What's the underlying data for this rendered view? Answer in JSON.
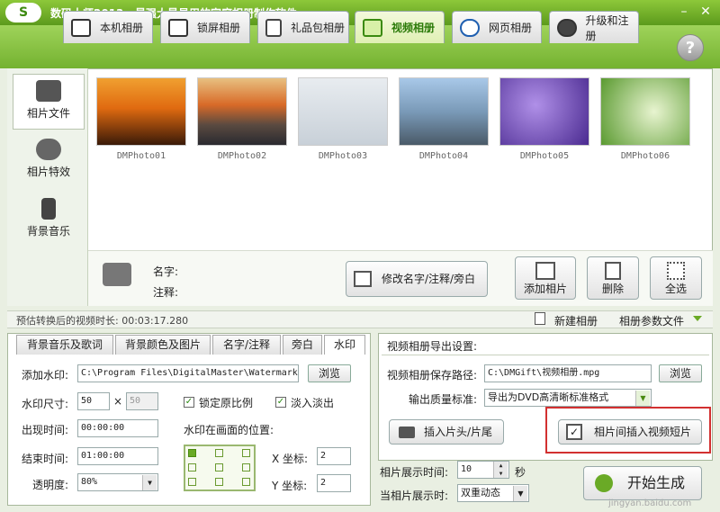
{
  "titlebar": {
    "logo": "S",
    "app_name": "数码大师2013",
    "slogan": "最强大最易用的家庭相册制作软件"
  },
  "tabs": [
    {
      "label": "本机相册"
    },
    {
      "label": "锁屏相册"
    },
    {
      "label": "礼品包相册"
    },
    {
      "label": "视频相册"
    },
    {
      "label": "网页相册"
    },
    {
      "label": "升级和注册"
    }
  ],
  "help_label": "?",
  "sidenav": {
    "items": [
      {
        "label": "相片文件"
      },
      {
        "label": "相片特效"
      },
      {
        "label": "背景音乐"
      }
    ]
  },
  "photos": [
    {
      "name": "DMPhoto01"
    },
    {
      "name": "DMPhoto02"
    },
    {
      "name": "DMPhoto03"
    },
    {
      "name": "DMPhoto04"
    },
    {
      "name": "DMPhoto05"
    },
    {
      "name": "DMPhoto06"
    }
  ],
  "info": {
    "name_label": "名字:",
    "note_label": "注释:",
    "edit_button": "修改名字/注释/旁白"
  },
  "actions": {
    "add": "添加相片",
    "delete": "删除",
    "select_all": "全选"
  },
  "status": {
    "estimate": "预估转换后的视频时长: 00:03:17.280",
    "new_album": "新建相册",
    "album_params": "相册参数文件"
  },
  "subtabs": [
    {
      "label": "背景音乐及歌词"
    },
    {
      "label": "背景颜色及图片"
    },
    {
      "label": "名字/注释"
    },
    {
      "label": "旁白"
    },
    {
      "label": "水印"
    }
  ],
  "watermark": {
    "add_label": "添加水印:",
    "path_value": "C:\\Program Files\\DigitalMaster\\Watermark",
    "browse": "浏览",
    "size_label": "水印尺寸:",
    "size_w": "50",
    "size_times": "×",
    "size_h": "50",
    "lock_ratio": "锁定原比例",
    "fade": "淡入淡出",
    "appear_label": "出现时间:",
    "appear_value": "00:00:00",
    "end_label": "结束时间:",
    "end_value": "01:00:00",
    "opacity_label": "透明度:",
    "opacity_value": "80%",
    "position_label": "水印在画面的位置:",
    "x_label": "X 坐标:",
    "x_value": "2",
    "y_label": "Y 坐标:",
    "y_value": "2"
  },
  "export": {
    "header": "视频相册导出设置:",
    "path_label": "视频相册保存路径:",
    "path_value": "C:\\DMGift\\视频相册.mpg",
    "browse": "浏览",
    "quality_label": "输出质量标准:",
    "quality_value": "导出为DVD高清晰标准格式",
    "insert_head": "插入片头/片尾",
    "insert_short": "相片间插入视频短片"
  },
  "display": {
    "time_label": "相片展示时间:",
    "time_value": "10",
    "time_unit": "秒",
    "effect_label": "当相片展示时:",
    "effect_value": "双重动态"
  },
  "start_button": "开始生成",
  "watermark_brand": "jingyan.baidu.com",
  "colors": {
    "accent_green": "#6aaa26",
    "highlight_red": "#d23030"
  }
}
